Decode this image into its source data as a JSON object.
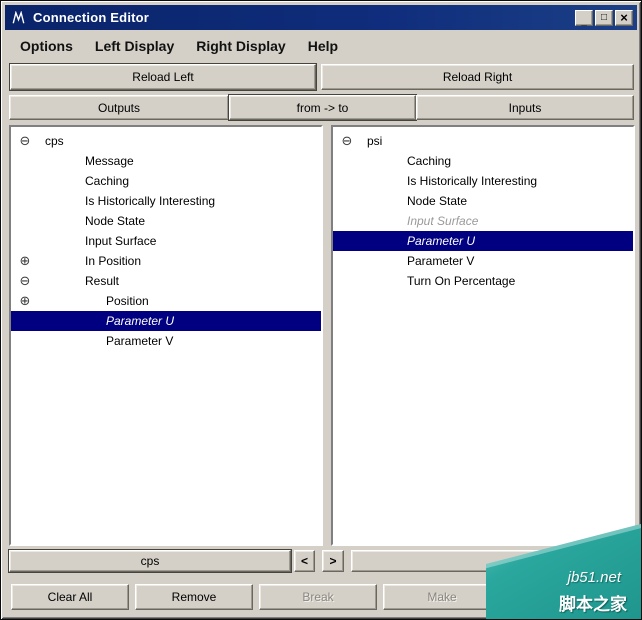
{
  "titlebar": {
    "title": "Connection Editor",
    "minimize_icon": "_",
    "maximize_icon": "□",
    "close_icon": "×"
  },
  "menu": {
    "items": [
      {
        "label": "Options"
      },
      {
        "label": "Left Display"
      },
      {
        "label": "Right Display"
      },
      {
        "label": "Help"
      }
    ]
  },
  "reload": {
    "left": "Reload Left",
    "right": "Reload Right"
  },
  "headers": {
    "outputs": "Outputs",
    "from_to": "from -> to",
    "inputs": "Inputs"
  },
  "left_tree": {
    "items": [
      {
        "label": "cps",
        "level": 0,
        "expander_icon": "⊖"
      },
      {
        "label": "Message",
        "level": 1
      },
      {
        "label": "Caching",
        "level": 1
      },
      {
        "label": "Is Historically Interesting",
        "level": 1
      },
      {
        "label": "Node State",
        "level": 1
      },
      {
        "label": "Input Surface",
        "level": 1
      },
      {
        "label": "In Position",
        "level": 1,
        "expander_icon": "⊕"
      },
      {
        "label": "Result",
        "level": 1,
        "expander_icon": "⊖"
      },
      {
        "label": "Position",
        "level": 2,
        "expander_icon": "⊕"
      },
      {
        "label": "Parameter U",
        "level": 2,
        "selected": true,
        "italic": true
      },
      {
        "label": "Parameter V",
        "level": 2
      }
    ]
  },
  "right_tree": {
    "items": [
      {
        "label": "psi",
        "level": 0,
        "expander_icon": "⊖"
      },
      {
        "label": "Caching",
        "level": 1
      },
      {
        "label": "Is Historically Interesting",
        "level": 1
      },
      {
        "label": "Node State",
        "level": 1
      },
      {
        "label": "Input Surface",
        "level": 1,
        "italic": true,
        "grayed": true
      },
      {
        "label": "Parameter U",
        "level": 1,
        "selected": true,
        "italic": true
      },
      {
        "label": "Parameter V",
        "level": 1
      },
      {
        "label": "Turn On Percentage",
        "level": 1
      }
    ]
  },
  "bottom": {
    "left_field": "cps",
    "prev_icon": "<",
    "next_icon": ">",
    "right_field": ""
  },
  "actions": [
    {
      "label": "Clear All"
    },
    {
      "label": "Remove"
    },
    {
      "label": "Break",
      "disabled": true
    },
    {
      "label": "Make",
      "disabled": true
    }
  ],
  "watermark": {
    "site": "jb51.net",
    "name": "脚本之家"
  },
  "colors": {
    "titlebar": "#0a246a",
    "selection": "#000080",
    "face": "#d4d0c8",
    "watermark_teal": "#2aa79e"
  }
}
